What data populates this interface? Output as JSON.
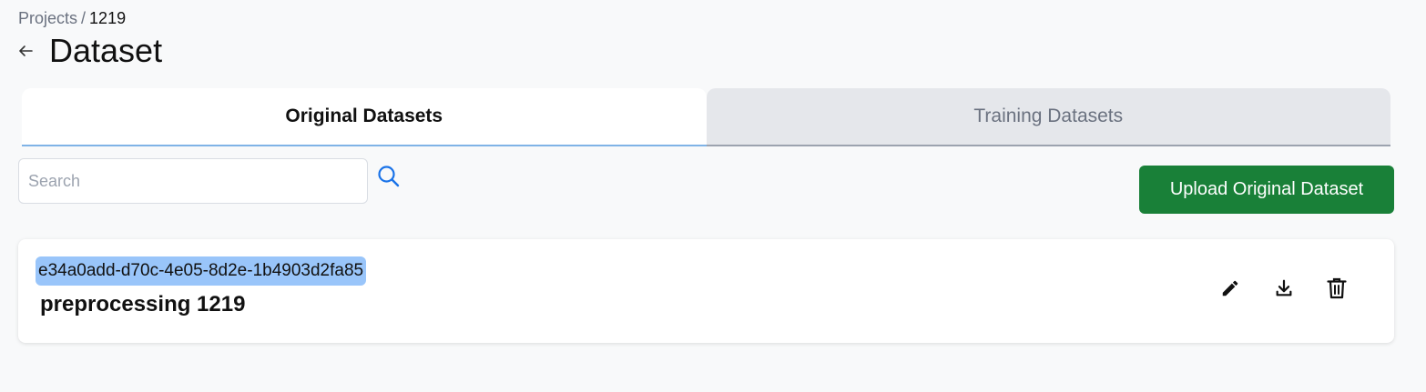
{
  "breadcrumb": {
    "parent": "Projects",
    "separator": "/",
    "current": "1219"
  },
  "page": {
    "title": "Dataset"
  },
  "tabs": [
    {
      "label": "Original Datasets",
      "active": true
    },
    {
      "label": "Training Datasets",
      "active": false
    }
  ],
  "search": {
    "placeholder": "Search",
    "value": ""
  },
  "upload_button": {
    "label": "Upload Original Dataset"
  },
  "datasets": [
    {
      "id": "e34a0add-d70c-4e05-8d2e-1b4903d2fa85",
      "name": "preprocessing 1219",
      "actions": [
        "edit-icon",
        "download-icon",
        "delete-icon"
      ]
    }
  ],
  "colors": {
    "primary_button": "#198038",
    "selection_highlight": "#99c5fa",
    "search_icon": "#1a73e8",
    "active_tab_underline": "#7fb3e6"
  }
}
